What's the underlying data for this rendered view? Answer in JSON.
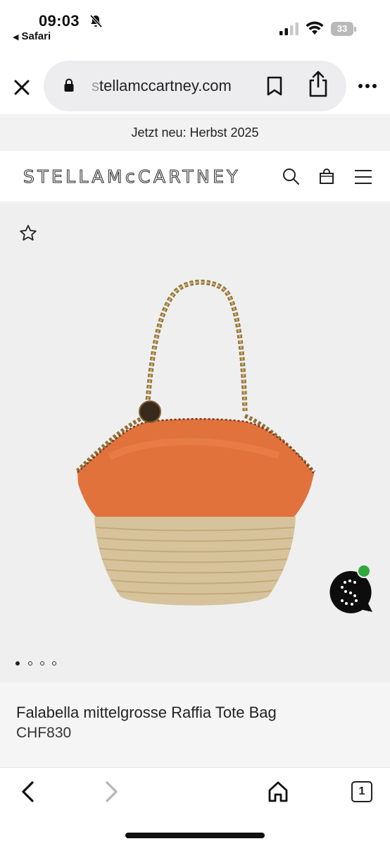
{
  "status_bar": {
    "time": "09:03",
    "back_app": "Safari",
    "battery": "33",
    "icons": [
      "bell-slash-icon",
      "signal-icon",
      "wifi-icon",
      "battery-icon"
    ]
  },
  "address_bar": {
    "url_faded": "s",
    "url": "tellamccartney.com",
    "icons": [
      "close-icon",
      "lock-icon",
      "bookmark-icon",
      "share-icon",
      "more-icon"
    ]
  },
  "promo": {
    "text": "Jetzt neu: Herbst 2025"
  },
  "header": {
    "logo": "STELLAMcCARTNEY",
    "icons": [
      "search-icon",
      "shopping-bag-icon",
      "menu-icon"
    ]
  },
  "gallery": {
    "image_count": 4,
    "active_index": 0,
    "icons": [
      "star-icon",
      "chat-icon"
    ]
  },
  "product": {
    "name": "Falabella mittelgrosse Raffia Tote Bag",
    "price": "CHF830"
  },
  "toolbar": {
    "tabs_count": "1",
    "icons": [
      "back-icon",
      "forward-icon",
      "home-icon",
      "tabs-icon"
    ]
  },
  "colors": {
    "bag_leather": "#e2723c",
    "raffia": "#d7c39b",
    "chain": "#a88a48",
    "gallery_bg": "#efefef",
    "chat_badge": "#2fa93a"
  }
}
